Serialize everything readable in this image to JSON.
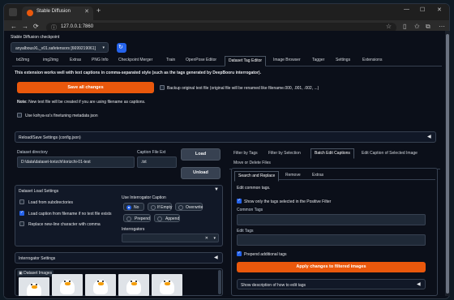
{
  "browser": {
    "tab_title": "Stable Diffusion",
    "url": "127.0.0.1:7860",
    "new_tab": "+",
    "close_tab": "✕",
    "back": "←",
    "forward": "→",
    "reload": "⟳",
    "minimize": "—",
    "maximize": "☐",
    "close": "✕"
  },
  "checkpoint": {
    "label": "Stable Diffusion checkpoint",
    "value": "anyalbousXL_v01.safetensors [6699219061]"
  },
  "top_tabs": [
    "txt2img",
    "img2img",
    "Extras",
    "PNG Info",
    "Checkpoint Merger",
    "Train",
    "OpenPose Editor",
    "Dataset Tag Editor",
    "Image Browser",
    "Tagger",
    "Settings",
    "Extensions"
  ],
  "info_text": "This extension works well with text captions in comma-separated style (such as the tags generated by DeepBooru interrogator).",
  "save_all_label": "Save all changes",
  "backup_label": "Backup original text file (original file will be renamed like filename.000, .001, .002, ...)",
  "note_prefix": "Note:",
  "note_text": " New text file will be created if you are using filename as captions.",
  "kohya_label": "Use kohya-ss's finetuning metadata json",
  "reload_settings_label": "Reload/Save Settings (config.json)",
  "dataset_dir_label": "Dataset directory",
  "dataset_dir_value": "D:\\data\\dataset-torizchi\\torizchi-01-test",
  "caption_ext_label": "Caption File Ext",
  "caption_ext_value": ".txt",
  "load_label": "Load",
  "unload_label": "Unload",
  "load_settings_label": "Dataset Load Settings",
  "load_subdirs_label": "Load from subdirectories",
  "load_caption_label": "Load caption from filename if no text file exists",
  "replace_newline_label": "Replace new-line character with comma",
  "use_interrogator_label": "Use Interrogator Caption",
  "interrogator_options": [
    "No",
    "If Empty",
    "Overwrite",
    "Prepend",
    "Append"
  ],
  "interrogators_label": "Interrogators",
  "interrogators_value": "",
  "clear_icon": "✕",
  "interrogator_settings_label": "Interrogator Settings",
  "dataset_images_label": "Dataset Images",
  "right_tabs_row1": [
    "Filter by Tags",
    "Filter by Selection",
    "Batch Edit Captions",
    "Edit Caption of Selected Image"
  ],
  "right_tabs_row2": [
    "Move or Delete Files"
  ],
  "sub_tabs": [
    "Search and Replace",
    "Remove",
    "Extras"
  ],
  "edit_common_tags_label": "Edit common tags.",
  "show_only_selected_label": "Show only the tags selected in the Positive Filter",
  "common_tags_label": "Common Tags",
  "common_tags_value": "",
  "edit_tags_label": "Edit Tags",
  "edit_tags_value": "",
  "prepend_label": "Prepend additional tags",
  "apply_label": "Apply changes to filtered images",
  "show_description_label": "Show description of how to edit tags",
  "colors": {
    "accent": "#ea580c",
    "blue": "#2563eb"
  }
}
